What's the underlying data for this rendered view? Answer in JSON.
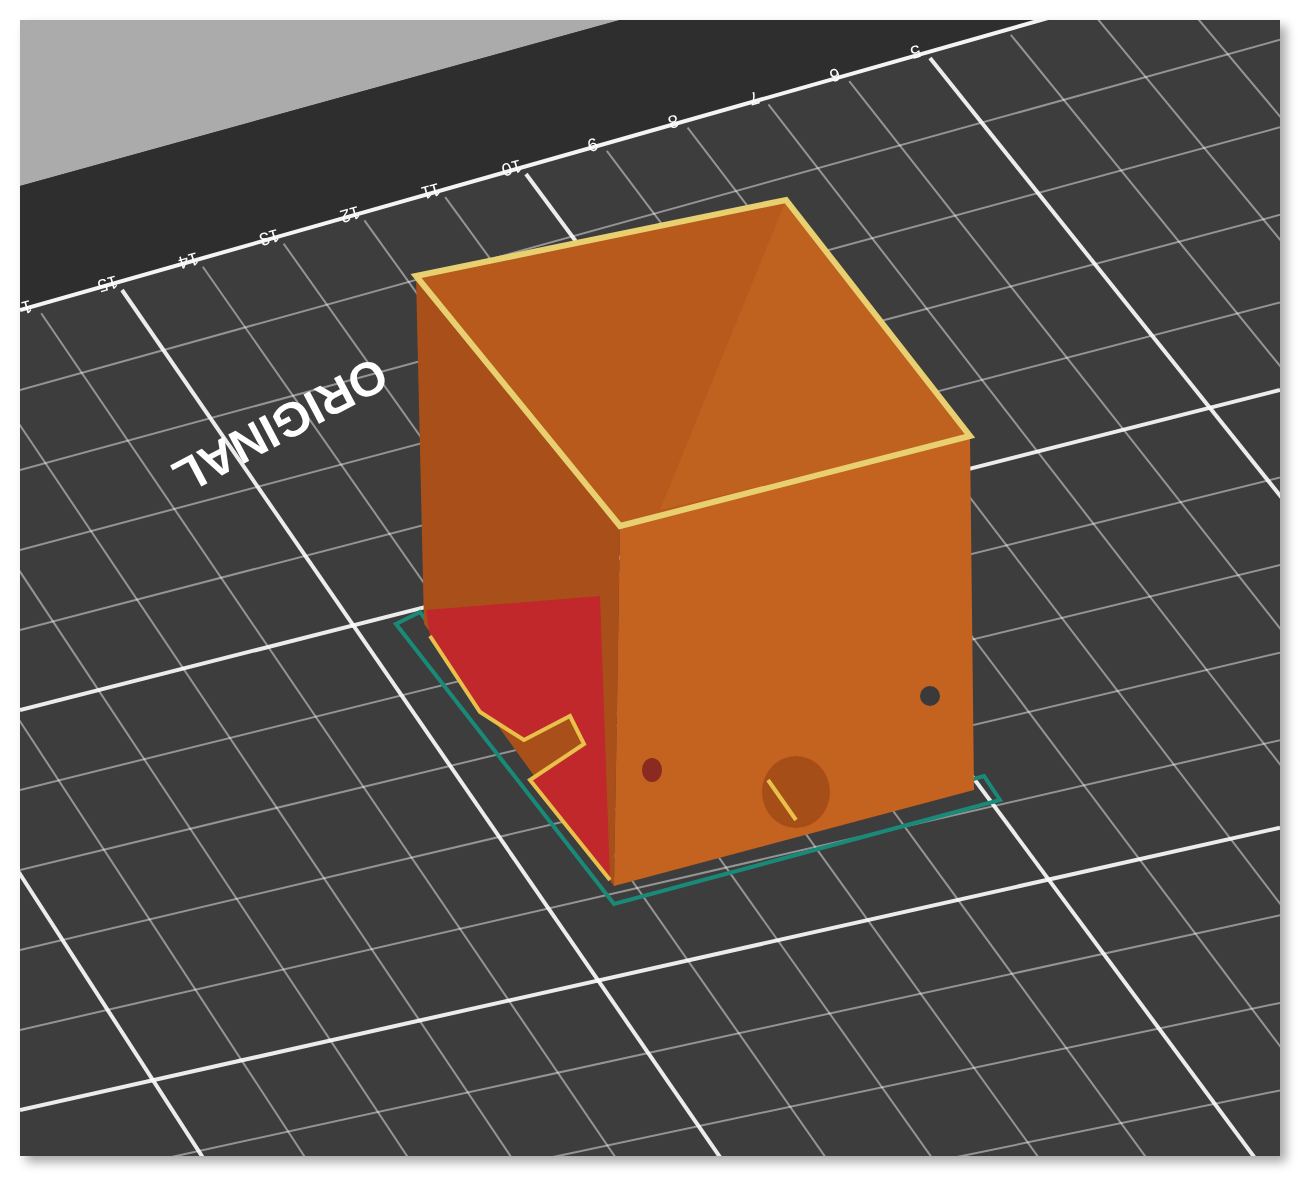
{
  "viewport": {
    "ruler_labels": [
      "1",
      "15",
      "14",
      "13",
      "12",
      "11",
      "10",
      "9",
      "8",
      "7",
      "6",
      "5"
    ],
    "bed_label": "ORIGINAL"
  }
}
